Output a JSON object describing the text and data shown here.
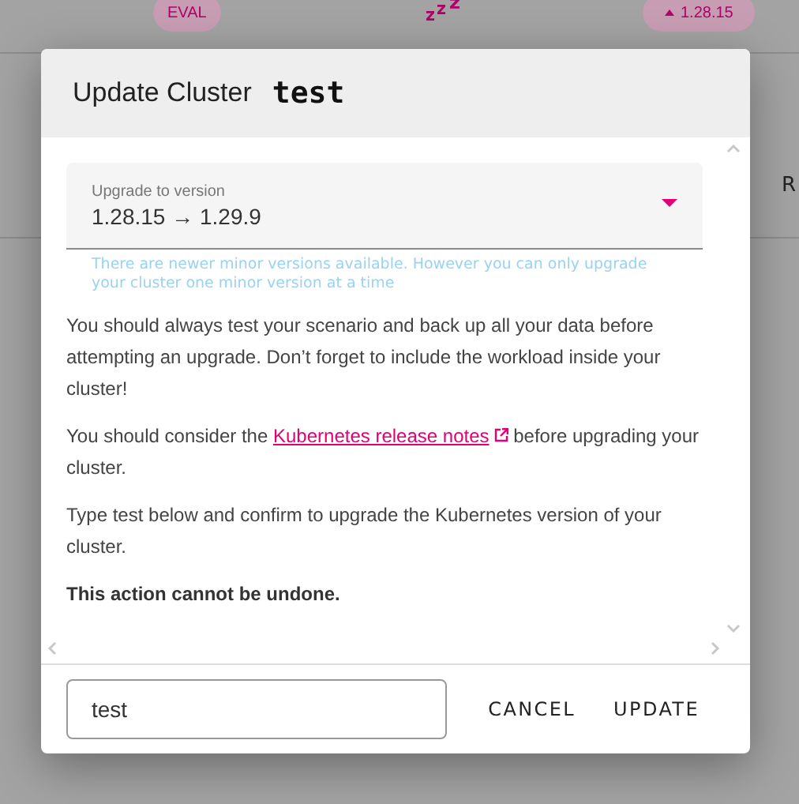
{
  "background": {
    "badges": [
      {
        "kind": "tag",
        "text": "EVAL"
      },
      {
        "kind": "version",
        "text": "1.28.15"
      }
    ],
    "column_text": "R"
  },
  "dialog": {
    "title": "Update Cluster",
    "cluster_name": "test",
    "version_select": {
      "label": "Upgrade to version",
      "value": "1.28.15 → 1.29.9",
      "hint": "There are newer minor versions available. However you can only upgrade your cluster one minor version at a time"
    },
    "paragraphs": [
      {
        "kind": "text",
        "text": "You should always test your scenario and back up all your data before attempting an upgrade. Don’t forget to include the workload inside your cluster!"
      },
      {
        "kind": "link",
        "before": "You should consider the ",
        "link": "Kubernetes release notes",
        "after": " before upgrading your cluster."
      },
      {
        "kind": "text",
        "text": "Type test below and confirm to upgrade the Kubernetes version of your cluster."
      },
      {
        "kind": "strong",
        "text": "This action cannot be undone."
      }
    ],
    "confirm_field": {
      "value": "test"
    },
    "buttons": [
      "CANCEL",
      "UPDATE"
    ]
  }
}
